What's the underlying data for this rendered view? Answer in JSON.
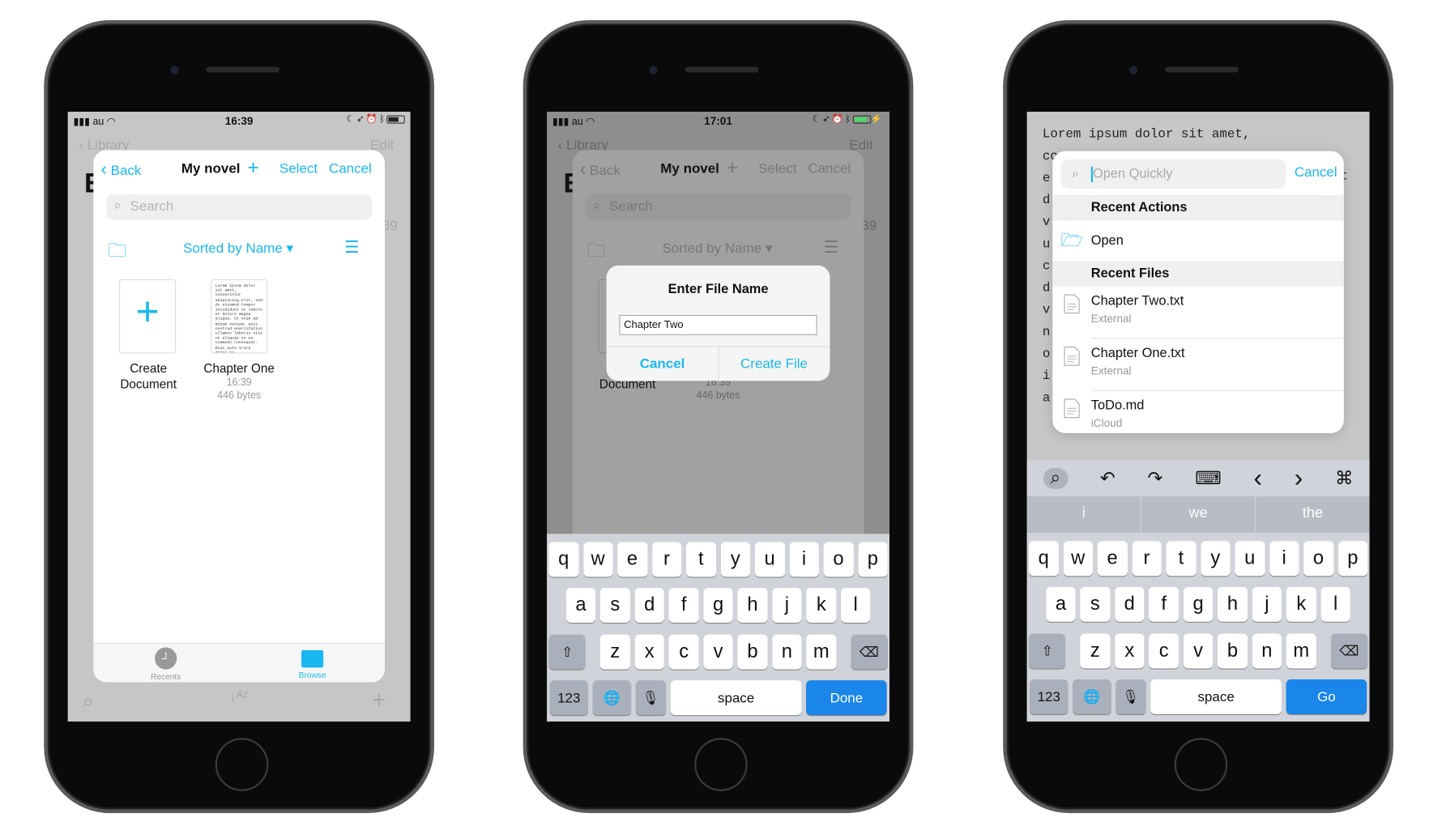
{
  "colors": {
    "accent": "#19b8f0",
    "go_button": "#1a86ea",
    "keyboard_bg": "#d0d3d9"
  },
  "phone1": {
    "status": {
      "carrier": "au",
      "time": "16:39"
    },
    "under": {
      "back": "Library",
      "edit": "Edit",
      "title_initial": "E",
      "row_time": "39"
    },
    "sheet": {
      "back": "Back",
      "title": "My novel",
      "select": "Select",
      "cancel": "Cancel",
      "search_placeholder": "Search",
      "sort": "Sorted by Name",
      "items": [
        {
          "label1": "Create",
          "label2": "Document"
        },
        {
          "name": "Chapter One",
          "time": "16:39",
          "size": "446 bytes"
        }
      ],
      "thumb_text": "Lorem ipsum dolor sit amet, consectetur adipiscing elit, sed do eiusmod tempor incididunt ut labore et dolore magna aliqua. Ut enim ad minim veniam, quis nostrud exercitation ullamco laboris nisi ut aliquip ex ea commodo consequat. Duis aute irure dolor in reprehenderit in voluptate velit esse",
      "tabs": [
        {
          "label": "Recents",
          "icon": "clock-icon",
          "active": false
        },
        {
          "label": "Browse",
          "icon": "folder-icon",
          "active": true
        }
      ]
    },
    "toolbar": {
      "icons": [
        "search-icon",
        "sort-az-icon",
        "plus-icon"
      ]
    }
  },
  "phone2": {
    "status": {
      "carrier": "au",
      "time": "17:01"
    },
    "under": {
      "back": "Library",
      "edit": "Edit",
      "title_initial": "E",
      "row_time": "39"
    },
    "sheet": {
      "back": "Back",
      "title": "My novel",
      "select": "Select",
      "cancel": "Cancel",
      "search_placeholder": "Search",
      "sort": "Sorted by Name",
      "doc_label": "Document",
      "doc_time": "16:39",
      "doc_size": "446 bytes"
    },
    "dialog": {
      "title": "Enter File Name",
      "value": "Chapter Two",
      "cancel": "Cancel",
      "confirm": "Create File"
    },
    "keyboard": {
      "rows": [
        [
          "q",
          "w",
          "e",
          "r",
          "t",
          "y",
          "u",
          "i",
          "o",
          "p"
        ],
        [
          "a",
          "s",
          "d",
          "f",
          "g",
          "h",
          "j",
          "k",
          "l"
        ],
        [
          "z",
          "x",
          "c",
          "v",
          "b",
          "n",
          "m"
        ]
      ],
      "num": "123",
      "space": "space",
      "return": "Done"
    }
  },
  "phone3": {
    "editor": {
      "first_line": "Lorem ipsum dolor sit amet,",
      "line_starts": [
        "co",
        "e",
        "d",
        "v",
        "u",
        "c",
        "d",
        "v",
        "n",
        "o",
        "i",
        "a"
      ],
      "right_fragment": "t"
    },
    "quick_open": {
      "placeholder": "Open Quickly",
      "cancel": "Cancel",
      "recent_actions": "Recent Actions",
      "open": "Open",
      "recent_files": "Recent Files",
      "files": [
        {
          "name": "Chapter Two.txt",
          "location": "External"
        },
        {
          "name": "Chapter One.txt",
          "location": "External"
        },
        {
          "name": "ToDo.md",
          "location": "iCloud"
        }
      ]
    },
    "kb_toolbar": {
      "icons": [
        "search-icon",
        "undo-icon",
        "redo-icon",
        "hide-keyboard-icon",
        "chevron-left-icon",
        "chevron-right-icon",
        "command-icon"
      ]
    },
    "suggestions": [
      "i",
      "we",
      "the"
    ],
    "keyboard": {
      "rows": [
        [
          "q",
          "w",
          "e",
          "r",
          "t",
          "y",
          "u",
          "i",
          "o",
          "p"
        ],
        [
          "a",
          "s",
          "d",
          "f",
          "g",
          "h",
          "j",
          "k",
          "l"
        ],
        [
          "z",
          "x",
          "c",
          "v",
          "b",
          "n",
          "m"
        ]
      ],
      "num": "123",
      "space": "space",
      "return": "Go"
    }
  }
}
